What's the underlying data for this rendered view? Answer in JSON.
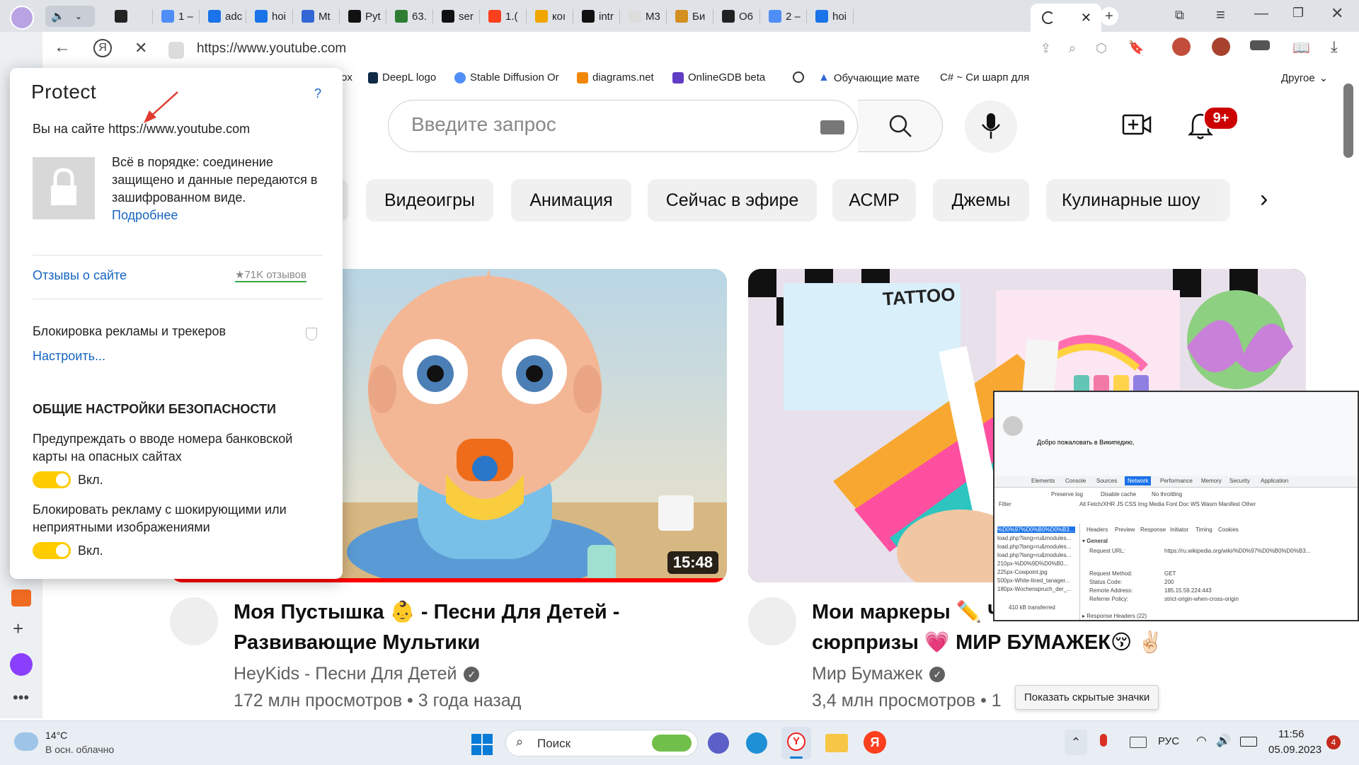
{
  "colors": {
    "accent_yellow": "#ffcc00",
    "link_blue": "#1565c0",
    "youtube_red": "#ff0000",
    "tab_strip": "#dfe3e8"
  },
  "browser": {
    "tabs": [
      {
        "label": "",
        "icon": "speaker-icon"
      },
      {
        "label": "",
        "icon": "openai-icon"
      },
      {
        "label": "1 –",
        "icon": "stable-diffusion-icon"
      },
      {
        "label": "adc",
        "icon": "document-icon"
      },
      {
        "label": "hoi",
        "icon": "document-icon"
      },
      {
        "label": "Mt",
        "icon": "py-icon"
      },
      {
        "label": "Pyt",
        "icon": "github-icon"
      },
      {
        "label": "63.",
        "icon": "acmp-icon"
      },
      {
        "label": "ser",
        "icon": "github-icon"
      },
      {
        "label": "1.(",
        "icon": "yandex-icon"
      },
      {
        "label": "кoı",
        "icon": "image-icon"
      },
      {
        "label": "intr",
        "icon": "github-icon"
      },
      {
        "label": "M3",
        "icon": "blank-icon"
      },
      {
        "label": "Би",
        "icon": "bookmark-icon"
      },
      {
        "label": "O6",
        "icon": "openai-icon"
      },
      {
        "label": "2 –",
        "icon": "stable-diffusion-icon"
      },
      {
        "label": "hoi",
        "icon": "document-icon"
      },
      {
        "label": "",
        "icon": "loading-icon"
      }
    ],
    "url": "https://www.youtube.com",
    "bookmarks": [
      {
        "label": "ox",
        "icon": "yandex-icon"
      },
      {
        "label": "DeepL logo",
        "icon": "deepl-icon"
      },
      {
        "label": "Stable Diffusion Or",
        "icon": "stable-diffusion-icon"
      },
      {
        "label": "diagrams.net",
        "icon": "diagrams-icon"
      },
      {
        "label": "OnlineGDB beta",
        "icon": "gdb-icon"
      },
      {
        "label": "",
        "icon": "openai-icon"
      },
      {
        "label": "Обучающие мате",
        "icon": "arrow-icon"
      },
      {
        "label": "C# ~ Си шарп для",
        "icon": "csharp-icon"
      }
    ],
    "bookmarks_other": "Другое"
  },
  "protect": {
    "title": "Protect",
    "help": "?",
    "site_text": "Вы на сайте https://www.youtube.com",
    "secure_text": "Всё в порядке: соединение защищено и данные передаются в зашифрованном виде.",
    "more_link": "Подробнее",
    "reviews_link": "Отзывы о сайте",
    "reviews_count": "★71K отзывов",
    "adblock_label": "Блокировка рекламы и трекеров",
    "configure_link": "Настроить...",
    "section_title": "ОБЩИЕ НАСТРОЙКИ БЕЗОПАСНОСТИ",
    "card_warning_label": "Предупреждать о вводе номера банковской карты на опасных сайтах",
    "card_warning_state": "Вкл.",
    "shocking_ads_label": "Блокировать рекламу с шокирующими или неприятными изображениями",
    "shocking_ads_state": "Вкл."
  },
  "youtube": {
    "search_placeholder": "Введите запрос",
    "notifications_badge": "9+",
    "chips": [
      "Видеоигры",
      "Анимация",
      "Сейчас в эфире",
      "АСМР",
      "Джемы",
      "Кулинарные шоу"
    ],
    "videos": [
      {
        "title_line1": "Моя Пустышка 👶  - Песни Для Детей -",
        "title_line2": "Развивающие Мультики",
        "channel": "HeyKids - Песни Для Детей",
        "meta": "172 млн просмотров • 3 года назад",
        "duration": "15:48"
      },
      {
        "title_line1": "Мои маркеры ✏️ Ч",
        "title_line2": "сюрпризы 💗  МИР БУМАЖЕК😚 ✌🏻",
        "channel": "Мир Бумажек",
        "meta": "3,4 млн просмотров • 1",
        "duration": ""
      }
    ],
    "thumb2_text": "TATTOO"
  },
  "tooltip": "Показать скрытые значки",
  "devtools": {
    "tabs": [
      "Elements",
      "Console",
      "Sources",
      "Network",
      "Performance",
      "Memory",
      "Security",
      "Application"
    ],
    "preserve": "Preserve log",
    "disable_cache": "Disable cache",
    "throttle": "No throttling",
    "filter": "Filter",
    "filter_types": "All  Fetch/XHR  JS  CSS  Img  Media  Font  Doc  WS  Wasm  Manifest  Other",
    "sub_tabs": [
      "Headers",
      "Preview",
      "Response",
      "Initiator",
      "Timing",
      "Cookies"
    ],
    "general": "▾ General",
    "rows": [
      {
        "k": "Request URL:",
        "v": "https://ru.wikipedia.org/wiki/%D0%97%D0%B0%D0%B3..."
      },
      {
        "k": "Request Method:",
        "v": "GET"
      },
      {
        "k": "Status Code:",
        "v": "200"
      },
      {
        "k": "Remote Address:",
        "v": "185.15.59.224:443"
      },
      {
        "k": "Referrer Policy:",
        "v": "strict-origin-when-cross-origin"
      }
    ],
    "files": [
      "%D0%97%D0%B0%D0%B3...",
      "load.php?lang=ru&modules...",
      "load.php?lang=ru&modules...",
      "load.php?lang=ru&modules...",
      "210px-%D0%9D%D0%B0...",
      "225px-Cowpoint.jpg",
      "500px-White-lined_tanager...",
      "180px-Wochenspruch_der_..."
    ],
    "transferred": "410 kB transferred",
    "response_headers": "▸ Response Headers (22)",
    "wiki_welcome": "Добро пожаловать в Википедию,"
  },
  "taskbar": {
    "weather_temp": "14°C",
    "weather_desc": "В осн. облачно",
    "search_label": "Поиск",
    "lang": "РУС",
    "time": "11:56",
    "date": "05.09.2023",
    "notif_count": "4"
  }
}
